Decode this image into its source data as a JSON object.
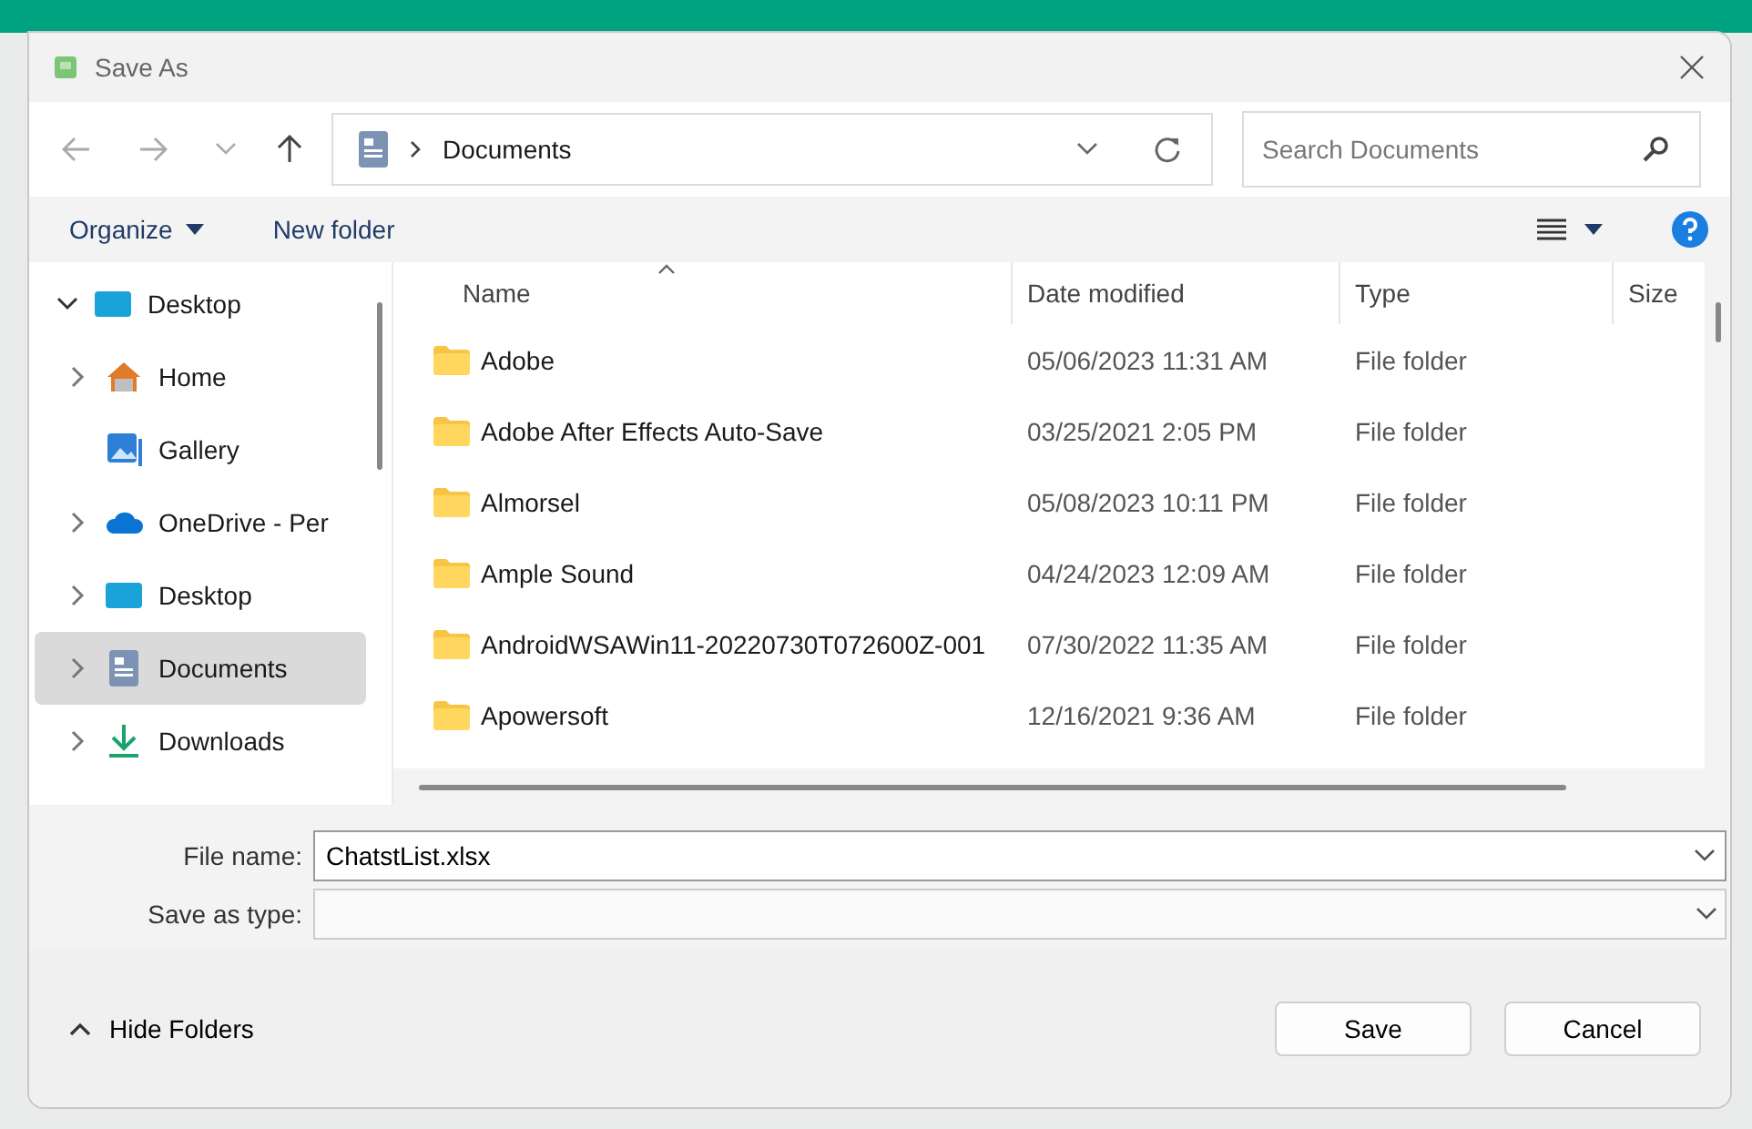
{
  "window": {
    "title": "Save As"
  },
  "address": {
    "path": "Documents"
  },
  "search": {
    "placeholder": "Search Documents"
  },
  "toolbar": {
    "organize": "Organize",
    "new_folder": "New folder"
  },
  "sidebar": {
    "items": [
      {
        "label": "Desktop",
        "kind": "desktop",
        "expandable": true,
        "expanded": true,
        "selected": false,
        "children": [
          {
            "label": "Home",
            "kind": "home",
            "expandable": true,
            "expanded": false,
            "selected": false
          },
          {
            "label": "Gallery",
            "kind": "gallery",
            "expandable": false,
            "expanded": false,
            "selected": false
          },
          {
            "label": "OneDrive - Per",
            "kind": "cloud",
            "expandable": true,
            "expanded": false,
            "selected": false
          },
          {
            "label": "Desktop",
            "kind": "desktop",
            "expandable": true,
            "expanded": false,
            "selected": false
          },
          {
            "label": "Documents",
            "kind": "documents",
            "expandable": true,
            "expanded": false,
            "selected": true
          },
          {
            "label": "Downloads",
            "kind": "downloads",
            "expandable": true,
            "expanded": false,
            "selected": false
          }
        ]
      }
    ]
  },
  "table": {
    "columns": [
      {
        "label": "Name",
        "sorted": true
      },
      {
        "label": "Date modified",
        "sorted": false
      },
      {
        "label": "Type",
        "sorted": false
      },
      {
        "label": "Size",
        "sorted": false
      }
    ],
    "rows": [
      {
        "name": "Adobe",
        "date": "05/06/2023 11:31 AM",
        "type": "File folder"
      },
      {
        "name": "Adobe After Effects Auto-Save",
        "date": "03/25/2021 2:05 PM",
        "type": "File folder"
      },
      {
        "name": "Almorsel",
        "date": "05/08/2023 10:11 PM",
        "type": "File folder"
      },
      {
        "name": "Ample Sound",
        "date": "04/24/2023 12:09 AM",
        "type": "File folder"
      },
      {
        "name": "AndroidWSAWin11-20220730T072600Z-001",
        "date": "07/30/2022 11:35 AM",
        "type": "File folder"
      },
      {
        "name": "Apowersoft",
        "date": "12/16/2021 9:36 AM",
        "type": "File folder"
      }
    ]
  },
  "form": {
    "file_name_label": "File name:",
    "file_name": "ChatstList.xlsx",
    "type_label": "Save as type:"
  },
  "footer": {
    "hide_folders": "Hide Folders",
    "buttons": [
      "Save",
      "Cancel"
    ]
  }
}
